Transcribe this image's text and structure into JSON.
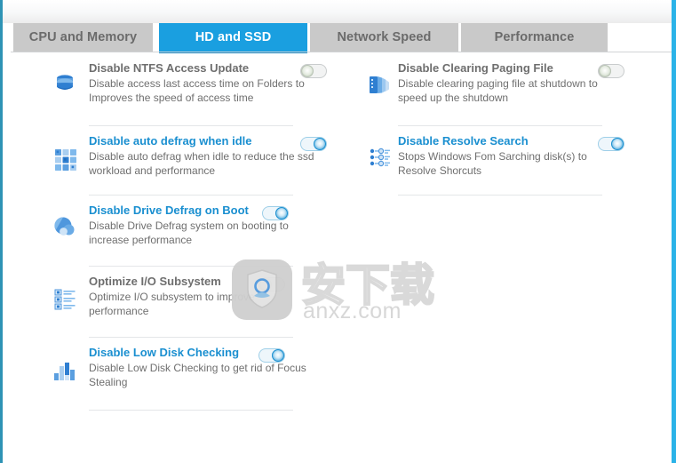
{
  "window": {
    "accent_color": "#1a9fe0",
    "left_edge_color": "#2e93b5",
    "right_edge_color": "#2bb3e8"
  },
  "tabs": [
    {
      "label": "CPU and Memory",
      "active": false
    },
    {
      "label": "HD and SSD",
      "active": true
    },
    {
      "label": "Network Speed",
      "active": false
    },
    {
      "label": "Performance",
      "active": false
    }
  ],
  "columns": {
    "left": [
      {
        "icon": "stacked-disks-icon",
        "title": "Disable NTFS Access Update",
        "description": "Disable access last access time on Folders to Improves the speed of access time",
        "toggle": "off",
        "title_color": "#6e6e6e"
      },
      {
        "icon": "defrag-grid-icon",
        "title": "Disable auto defrag when idle",
        "description": "Disable auto defrag when idle to reduce the ssd workload and performance",
        "toggle": "on",
        "title_color": "#1a8fd0"
      },
      {
        "icon": "disk-spheres-icon",
        "title": "Disable Drive Defrag on Boot",
        "description": "Disable Drive Defrag system on booting to increase performance",
        "toggle": "on",
        "title_color": "#1a8fd0"
      },
      {
        "icon": "detail-list-icon",
        "title": "Optimize I/O Subsystem",
        "description": "Optimize I/O subsystem to improve performance",
        "toggle": "off",
        "title_color": "#6e6e6e"
      },
      {
        "icon": "bar-chart-icon",
        "title": "Disable Low Disk Checking",
        "description": "Disable Low Disk Checking to get rid of Focus Stealing",
        "toggle": "on",
        "title_color": "#1a8fd0"
      }
    ],
    "right": [
      {
        "icon": "paging-file-icon",
        "title": "Disable Clearing Paging File",
        "description": "Disable clearing paging file at shutdown to speed up the shutdown",
        "toggle": "off",
        "title_color": "#6e6e6e"
      },
      {
        "icon": "resolve-search-icon",
        "title": "Disable Resolve Search",
        "description": "Stops Windows Fom Sarching disk(s) to Resolve Shorcuts",
        "toggle": "on",
        "title_color": "#1a8fd0"
      }
    ]
  },
  "watermark": {
    "logo_icon": "shield-app-logo",
    "chinese_text": "安下载",
    "domain": "anxz.com"
  }
}
